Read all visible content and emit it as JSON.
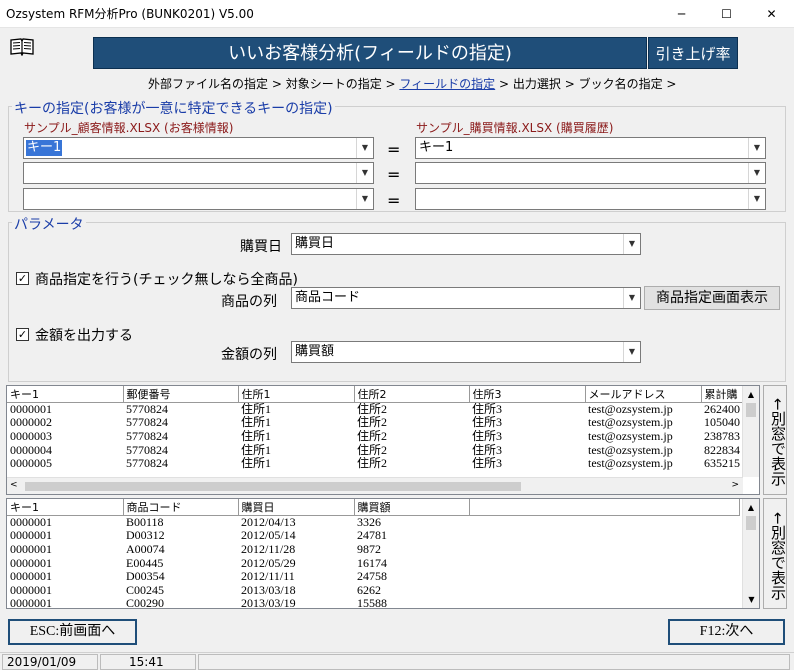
{
  "window": {
    "title": "Ozsystem RFM分析Pro (BUNK0201)   V5.00",
    "minimize": "─",
    "maximize": "☐",
    "close": "✕"
  },
  "header": {
    "banner": "いいお客様分析(フィールドの指定)",
    "banner_right": "引き上げ率",
    "book_icon": "book-icon"
  },
  "breadcrumb": [
    "外部ファイル名の指定 >",
    "対象シートの指定 >",
    "フィールドの指定",
    ">",
    "出力選択 >",
    "ブック名の指定 >"
  ],
  "key_section": {
    "title": "キーの指定(お客様が一意に特定できるキーの指定)",
    "left_label": "サンプル_顧客情報.XLSX (お客様情報)",
    "right_label": "サンプル_購買情報.XLSX (購買履歴)",
    "left_keys": [
      "キー1",
      "",
      ""
    ],
    "right_keys": [
      "キー1",
      "",
      ""
    ],
    "equals": "="
  },
  "params": {
    "title": "パラメータ",
    "purchase_date_label": "購買日",
    "purchase_date_value": "購買日",
    "product_check_label": "商品指定を行う(チェック無しなら全商品)",
    "product_check_mark": "✓",
    "product_col_label": "商品の列",
    "product_col_value": "商品コード",
    "product_button": "商品指定画面表示",
    "amount_check_label": "金額を出力する",
    "amount_check_mark": "✓",
    "amount_col_label": "金額の列",
    "amount_col_value": "購買額"
  },
  "grid1": {
    "columns": [
      "キー1",
      "郵便番号",
      "住所1",
      "住所2",
      "住所3",
      "メールアドレス",
      "累計購"
    ],
    "rows": [
      [
        "0000001",
        "5770824",
        "住所1",
        "住所2",
        "住所3",
        "test@ozsystem.jp",
        "262400"
      ],
      [
        "0000002",
        "5770824",
        "住所1",
        "住所2",
        "住所3",
        "test@ozsystem.jp",
        "105040"
      ],
      [
        "0000003",
        "5770824",
        "住所1",
        "住所2",
        "住所3",
        "test@ozsystem.jp",
        "238783"
      ],
      [
        "0000004",
        "5770824",
        "住所1",
        "住所2",
        "住所3",
        "test@ozsystem.jp",
        "822834"
      ],
      [
        "0000005",
        "5770824",
        "住所1",
        "住所2",
        "住所3",
        "test@ozsystem.jp",
        "635215"
      ]
    ],
    "side_button": "←別窓で表示"
  },
  "grid2": {
    "columns": [
      "キー1",
      "商品コード",
      "購買日",
      "購買額",
      ""
    ],
    "rows": [
      [
        "0000001",
        "B00118",
        "2012/04/13",
        "3326"
      ],
      [
        "0000001",
        "D00312",
        "2012/05/14",
        "24781"
      ],
      [
        "0000001",
        "A00074",
        "2012/11/28",
        "9872"
      ],
      [
        "0000001",
        "E00445",
        "2012/05/29",
        "16174"
      ],
      [
        "0000001",
        "D00354",
        "2012/11/11",
        "24758"
      ],
      [
        "0000001",
        "C00245",
        "2013/03/18",
        "6262"
      ],
      [
        "0000001",
        "C00290",
        "2013/03/19",
        "15588"
      ]
    ],
    "side_button": "←別窓で表示"
  },
  "footer": {
    "back_button": "ESC:前画面へ",
    "next_button": "F12:次へ"
  },
  "status": {
    "date": "2019/01/09",
    "time": "15:41"
  }
}
